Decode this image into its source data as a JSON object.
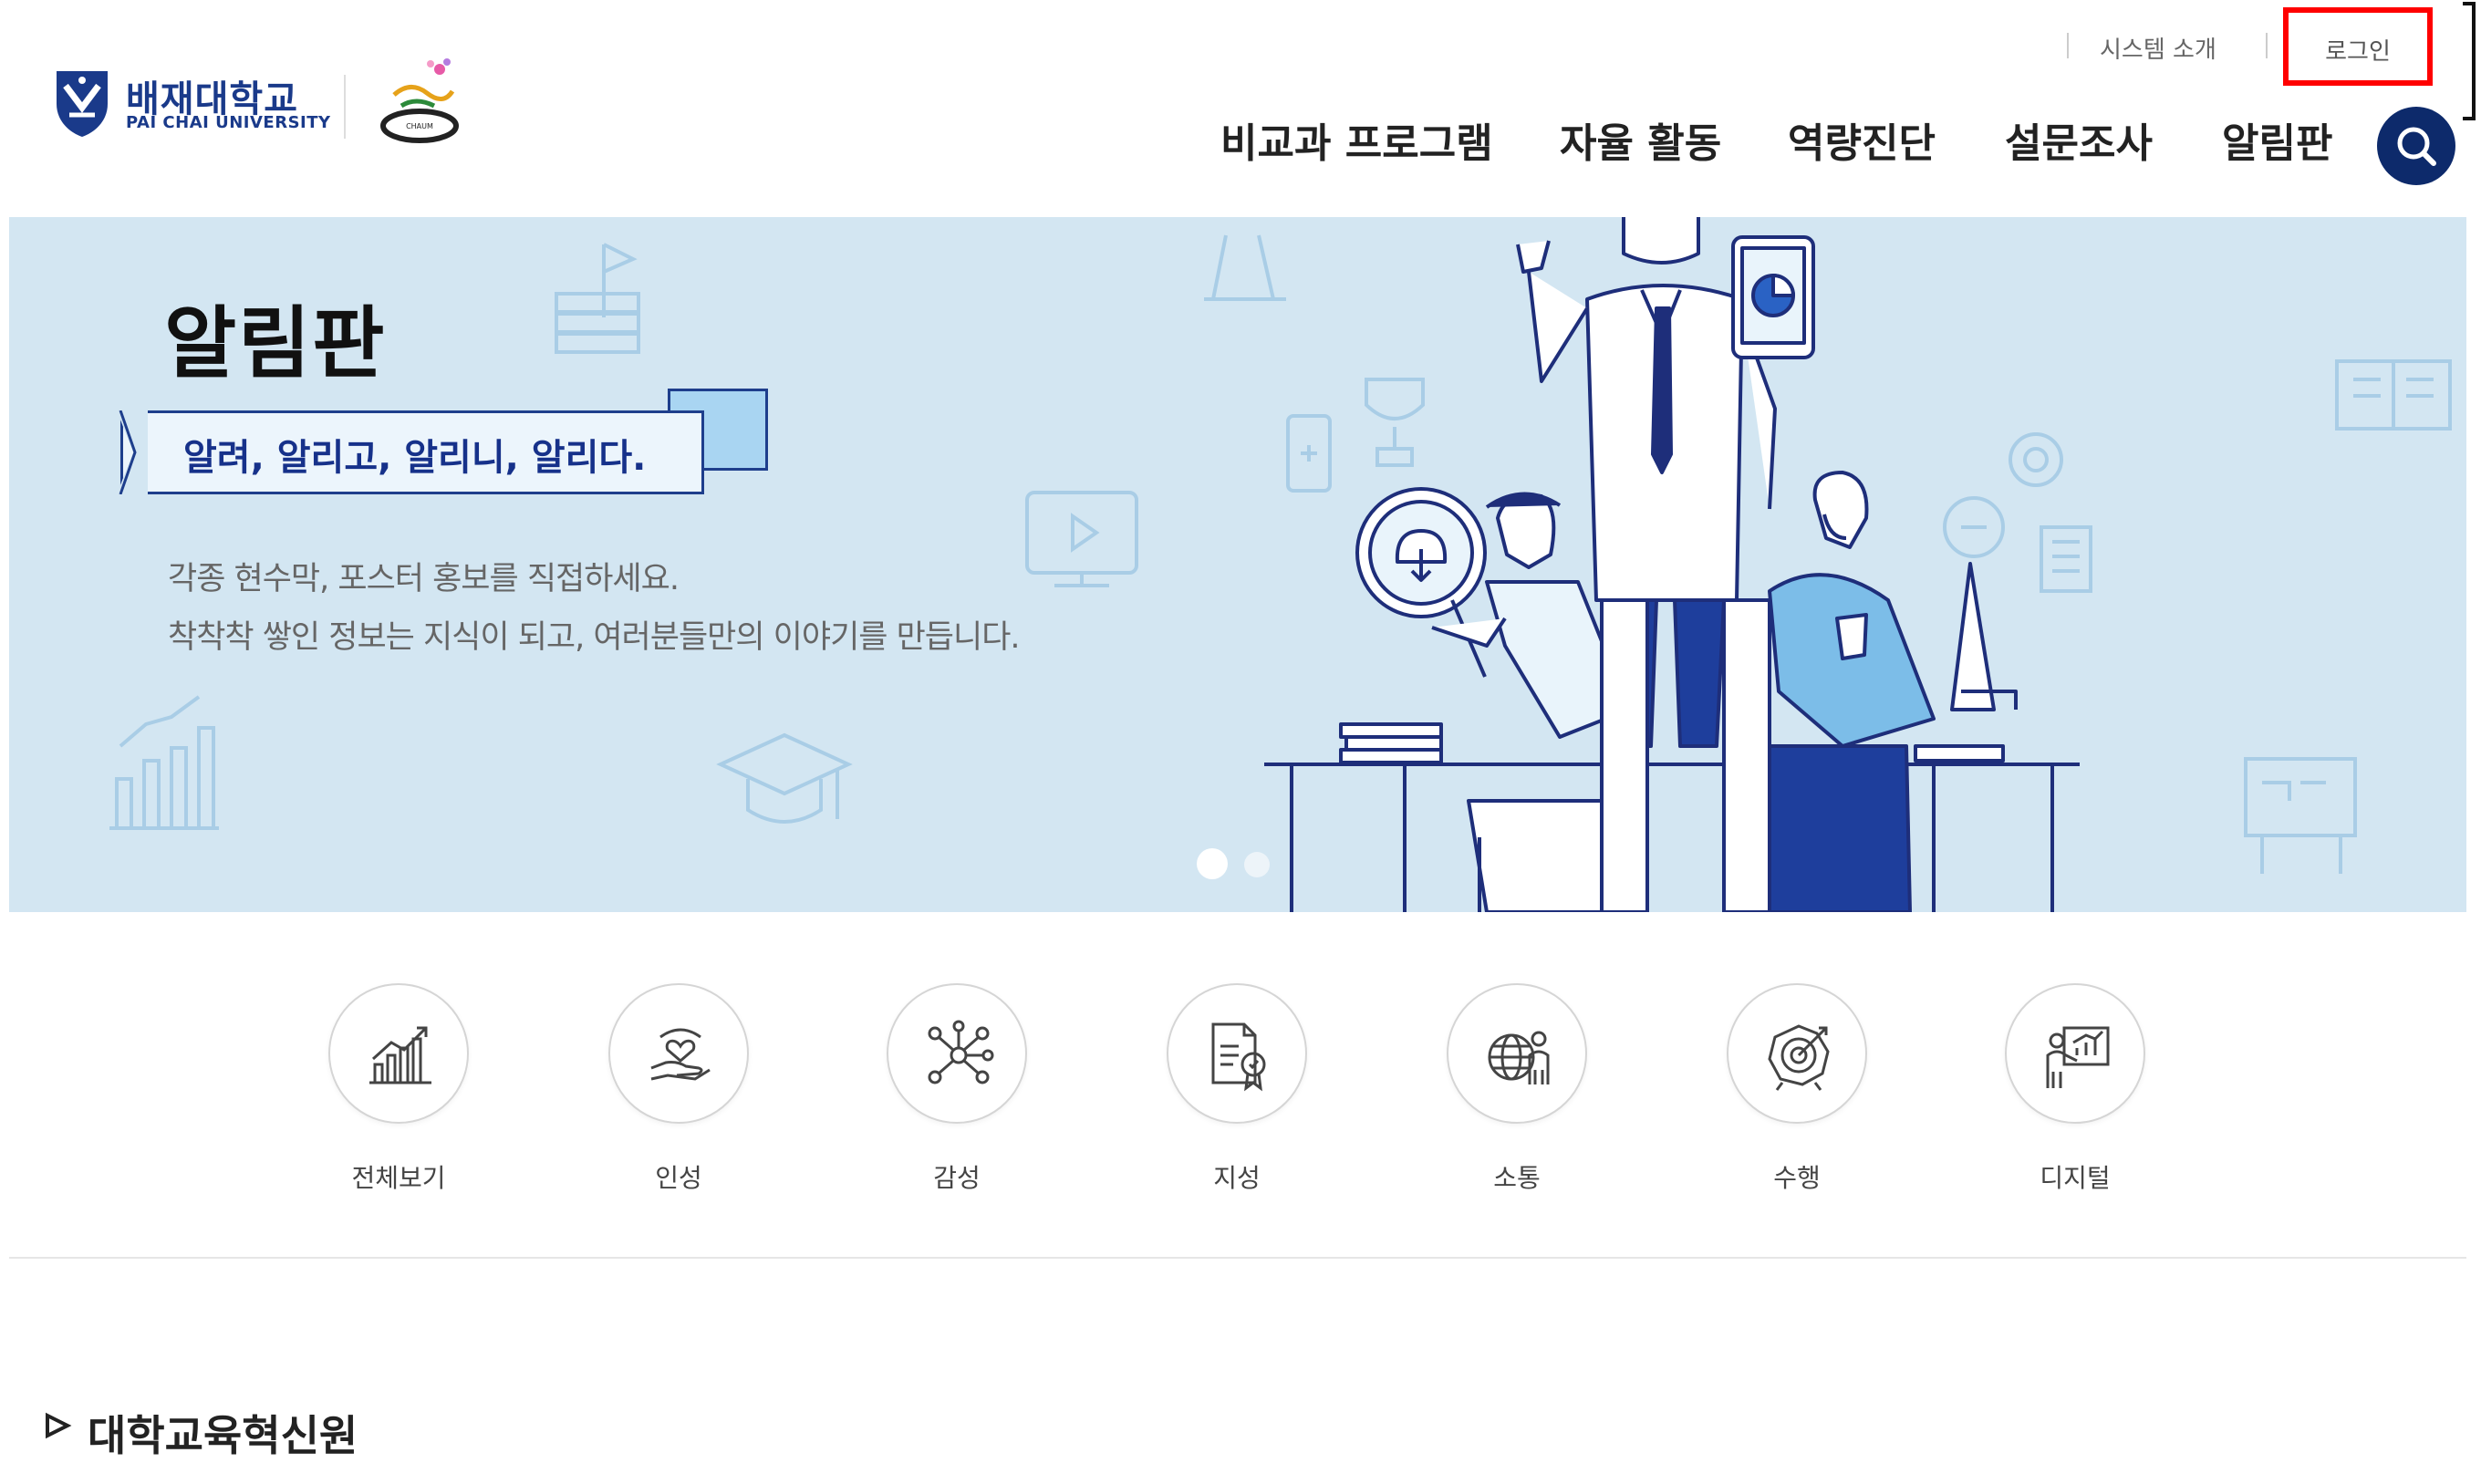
{
  "header": {
    "logo": {
      "name_ko": "배재대학교",
      "name_en": "PAI CHAI UNIVERSITY",
      "emblem_icon": "paichai-shield-emblem",
      "sub_logo_icon": "chaeum-logo"
    },
    "utility": {
      "system_intro_label": "시스템 소개",
      "login_label": "로그인"
    },
    "nav": [
      {
        "label": "비교과 프로그램"
      },
      {
        "label": "자율 활동"
      },
      {
        "label": "역량진단"
      },
      {
        "label": "설문조사"
      },
      {
        "label": "알림판"
      }
    ],
    "search_icon": "search-icon"
  },
  "banner": {
    "title": "알림판",
    "ribbon_text": "알려, 알리고, 알리니, 알리다.",
    "desc_line1": "각종 현수막, 포스터 홍보를 직접하세요.",
    "desc_line2": "착착착 쌓인 정보는 지식이 되고, 여러분들만의 이야기를 만듭니다.",
    "slides_total": 2,
    "active_slide": 1
  },
  "categories": [
    {
      "label": "전체보기",
      "icon": "growth-chart-icon"
    },
    {
      "label": "인성",
      "icon": "hand-heart-icon"
    },
    {
      "label": "감성",
      "icon": "network-icon"
    },
    {
      "label": "지성",
      "icon": "certificate-icon"
    },
    {
      "label": "소통",
      "icon": "globe-person-icon"
    },
    {
      "label": "수행",
      "icon": "target-icon"
    },
    {
      "label": "디지털",
      "icon": "digital-board-icon"
    }
  ],
  "section": {
    "heading": "대학교육혁신원"
  },
  "colors": {
    "brand_navy": "#0d2a6b",
    "banner_bg": "#d3e6f2",
    "highlight_red": "#ff0000"
  }
}
